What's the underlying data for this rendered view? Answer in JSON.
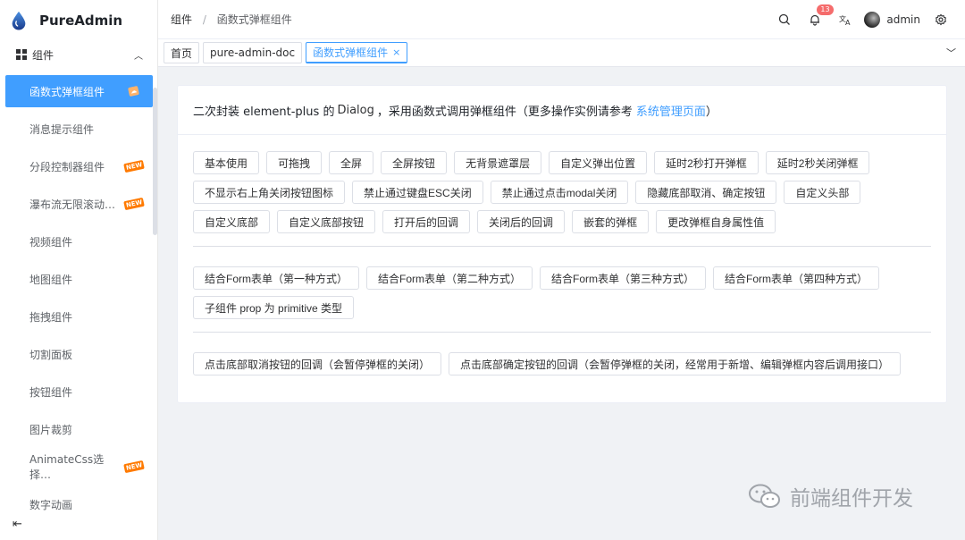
{
  "app": {
    "title": "PureAdmin"
  },
  "sidebar": {
    "group_label": "组件",
    "items": [
      {
        "label": "函数式弹框组件",
        "active": true,
        "new": false,
        "badge": ""
      },
      {
        "label": "消息提示组件",
        "new": false
      },
      {
        "label": "分段控制器组件",
        "new": true
      },
      {
        "label": "瀑布流无限滚动…",
        "new": true
      },
      {
        "label": "视频组件",
        "new": false
      },
      {
        "label": "地图组件",
        "new": false
      },
      {
        "label": "拖拽组件",
        "new": false
      },
      {
        "label": "切割面板",
        "new": false
      },
      {
        "label": "按钮组件",
        "new": false
      },
      {
        "label": "图片裁剪",
        "new": false
      },
      {
        "label": "AnimateCss选择…",
        "new": true
      },
      {
        "label": "数字动画",
        "new": false
      }
    ],
    "new_label": "NEW"
  },
  "header": {
    "breadcrumb": [
      "组件",
      "函数式弹框组件"
    ],
    "breadcrumb_sep": "/",
    "notification_count": "13",
    "user_name": "admin"
  },
  "tabs": [
    {
      "label": "首页",
      "active": false
    },
    {
      "label": "pure-admin-doc",
      "active": false
    },
    {
      "label": "函数式弹框组件",
      "active": true
    }
  ],
  "card": {
    "title_prefix": "二次封装 element-plus 的",
    "title_dialog": "Dialog",
    "title_suffix": "，采用函数式调用弹框组件（更多操作实例请参考",
    "title_link": "系统管理页面",
    "title_end": "）",
    "group1": [
      "基本使用",
      "可拖拽",
      "全屏",
      "全屏按钮",
      "无背景遮罩层",
      "自定义弹出位置",
      "延时2秒打开弹框",
      "延时2秒关闭弹框",
      "不显示右上角关闭按钮图标",
      "禁止通过键盘ESC关闭",
      "禁止通过点击modal关闭",
      "隐藏底部取消、确定按钮",
      "自定义头部",
      "自定义底部",
      "自定义底部按钮",
      "打开后的回调",
      "关闭后的回调",
      "嵌套的弹框",
      "更改弹框自身属性值"
    ],
    "group2": [
      "结合Form表单（第一种方式）",
      "结合Form表单（第二种方式）",
      "结合Form表单（第三种方式）",
      "结合Form表单（第四种方式）",
      "子组件 prop 为 primitive 类型"
    ],
    "group3": [
      "点击底部取消按钮的回调（会暂停弹框的关闭）",
      "点击底部确定按钮的回调（会暂停弹框的关闭，经常用于新增、编辑弹框内容后调用接口）"
    ]
  },
  "watermark": "前端组件开发",
  "colors": {
    "primary": "#409eff",
    "badge": "#f56c6c"
  }
}
